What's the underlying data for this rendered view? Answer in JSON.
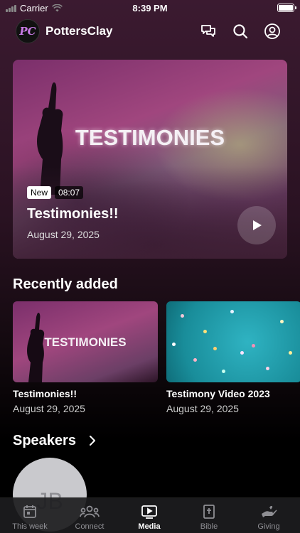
{
  "status_bar": {
    "carrier": "Carrier",
    "time": "8:39 PM"
  },
  "header": {
    "app_title": "PottersClay",
    "logo_text": "PC",
    "icons": [
      "chat-icon",
      "search-icon",
      "account-icon"
    ]
  },
  "hero": {
    "artwork_text": "TESTIMONIES",
    "badge_new": "New",
    "duration": "08:07",
    "title": "Testimonies!!",
    "date": "August 29, 2025"
  },
  "recently_added": {
    "title": "Recently added",
    "items": [
      {
        "artwork_text": "TESTIMONIES",
        "title": "Testimonies!!",
        "date": "August 29, 2025"
      },
      {
        "title": "Testimony Video 2023",
        "date": "August 29, 2025"
      }
    ]
  },
  "speakers": {
    "title": "Speakers",
    "items": [
      {
        "initials": "JB"
      }
    ]
  },
  "tab_bar": {
    "tabs": [
      {
        "label": "This week",
        "icon": "calendar-icon",
        "active": false
      },
      {
        "label": "Connect",
        "icon": "people-icon",
        "active": false
      },
      {
        "label": "Media",
        "icon": "play-tv-icon",
        "active": true
      },
      {
        "label": "Bible",
        "icon": "bible-icon",
        "active": false
      },
      {
        "label": "Giving",
        "icon": "giving-hand-icon",
        "active": false
      }
    ]
  }
}
